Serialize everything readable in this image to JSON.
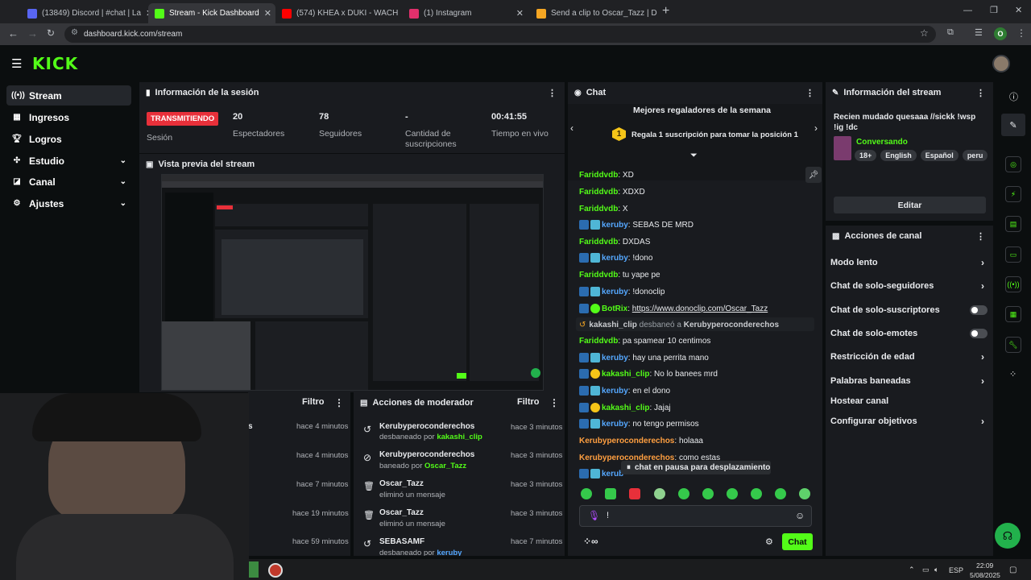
{
  "browser": {
    "tabs": [
      {
        "title": "(13849) Discord | #⁠chat | La",
        "fav": "#5865f2"
      },
      {
        "title": "Stream - Kick Dashboard",
        "fav": "#53fc18"
      },
      {
        "title": "(574) KHEA x DUKI - WACH",
        "fav": "#ff0000"
      },
      {
        "title": "(1) Instagram",
        "fav": "#e1306c"
      },
      {
        "title": "Send a clip to Oscar_Tazz | Don",
        "fav": "#f5a623"
      }
    ],
    "url": "dashboard.kick.com/stream",
    "profile_initial": "O"
  },
  "sidebar": {
    "items": [
      {
        "label": "Stream",
        "icon": "stream-icon"
      },
      {
        "label": "Ingresos",
        "icon": "revenue-icon"
      },
      {
        "label": "Logros",
        "icon": "trophy-icon"
      },
      {
        "label": "Estudio",
        "icon": "studio-icon"
      },
      {
        "label": "Canal",
        "icon": "channel-icon"
      },
      {
        "label": "Ajustes",
        "icon": "settings-icon"
      }
    ]
  },
  "session": {
    "title": "Información de la sesión",
    "live_badge": "TRANSMITIENDO",
    "session_label": "Sesión",
    "viewers": "20",
    "viewers_label": "Espectadores",
    "followers": "78",
    "followers_label": "Seguidores",
    "subs": "-",
    "subs_label": "Cantidad de suscripciones",
    "uptime": "00:41:55",
    "uptime_label": "Tiempo en vivo"
  },
  "preview": {
    "title": "Vista previa del stream"
  },
  "mod_left": {
    "filter": "Filtro",
    "times": [
      "hace 4 minutos",
      "hace 4 minutos",
      "hace 7 minutos",
      "hace 19 minutos",
      "hace 59 minutos"
    ],
    "stub": "s"
  },
  "mod_actions": {
    "title": "Acciones de moderador",
    "filter": "Filtro",
    "rows": [
      {
        "user": "Kerubyperoconderechos",
        "action": "desbaneado por",
        "by": "kakashi_clip",
        "time": "hace 3 minutos"
      },
      {
        "user": "Kerubyperoconderechos",
        "action": "baneado por",
        "by": "Oscar_Tazz",
        "time": "hace 3 minutos"
      },
      {
        "user": "Oscar_Tazz",
        "action": "eliminó un mensaje",
        "by": "",
        "time": "hace 3 minutos"
      },
      {
        "user": "Oscar_Tazz",
        "action": "eliminó un mensaje",
        "by": "",
        "time": "hace 3 minutos"
      },
      {
        "user": "SEBASAMF",
        "action": "desbaneado por",
        "by": "keruby",
        "time": "hace 7 minutos"
      }
    ]
  },
  "chat": {
    "title": "Chat",
    "gifters_title": "Mejores regaladores de la semana",
    "gift_cta": "Regala 1 suscripción para tomar la posición 1",
    "gift_rank": "1",
    "messages": [
      {
        "user": "Fariddvdb",
        "text": "XD",
        "color": "green",
        "badges": 0
      },
      {
        "user": "Fariddvdb",
        "text": "XDXD",
        "color": "green",
        "badges": 0
      },
      {
        "user": "Fariddvdb",
        "text": "X",
        "color": "green",
        "badges": 0
      },
      {
        "user": "keruby",
        "text": "SEBAS DE MRD",
        "color": "blue",
        "badges": 2
      },
      {
        "user": "Fariddvdb",
        "text": "DXDAS",
        "color": "green",
        "badges": 0
      },
      {
        "user": "keruby",
        "text": "!dono",
        "color": "blue",
        "badges": 2
      },
      {
        "user": "Fariddvdb",
        "text": "tu yape pe",
        "color": "green",
        "badges": 0
      },
      {
        "user": "keruby",
        "text": "!donoclip",
        "color": "blue",
        "badges": 2
      },
      {
        "user": "BotRix",
        "text": "https://www.donoclip.com/Oscar_Tazz",
        "color": "green",
        "badges": 2
      },
      {
        "user": "Fariddvdb",
        "text": "pa spamear 10 centimos",
        "color": "green",
        "badges": 0
      },
      {
        "user": "keruby",
        "text": "hay una perrita mano",
        "color": "blue",
        "badges": 2
      },
      {
        "user": "kakashi_clip",
        "text": "No lo banees mrd",
        "color": "green",
        "badges": 2
      },
      {
        "user": "keruby",
        "text": "en el dono",
        "color": "blue",
        "badges": 2
      },
      {
        "user": "kakashi_clip",
        "text": "Jajaj",
        "color": "green",
        "badges": 2
      },
      {
        "user": "keruby",
        "text": "no tengo permisos",
        "color": "blue",
        "badges": 2
      },
      {
        "user": "Kerubyperoconderechos",
        "text": "holaaa",
        "color": "orange",
        "badges": 0
      },
      {
        "user": "Kerubyperoconderechos",
        "text": "como estas",
        "color": "orange",
        "badges": 0
      }
    ],
    "system": {
      "user": "kakashi_clip",
      "action": "desbaneó a",
      "target": "Kerubyperoconderechos"
    },
    "last_partial": "kerub",
    "paused": "chat en pausa para desplazamiento",
    "input_value": "!",
    "send": "Chat"
  },
  "stream_info": {
    "title_label": "Información del stream",
    "stream_title": "Recien mudado quesaaa //sickk !wsp !ig !dc",
    "category": "Conversando",
    "tags": [
      "18+",
      "English",
      "Español",
      "peru"
    ],
    "edit": "Editar"
  },
  "channel_actions": {
    "title": "Acciones de canal",
    "items": [
      {
        "label": "Modo lento",
        "kind": "arrow"
      },
      {
        "label": "Chat de solo-seguidores",
        "kind": "arrow"
      },
      {
        "label": "Chat de solo-suscriptores",
        "kind": "toggle"
      },
      {
        "label": "Chat de solo-emotes",
        "kind": "toggle"
      },
      {
        "label": "Restricción de edad",
        "kind": "arrow"
      },
      {
        "label": "Palabras baneadas",
        "kind": "arrow"
      },
      {
        "label": "Hostear canal",
        "kind": "none"
      },
      {
        "label": "Configurar objetivos",
        "kind": "arrow"
      }
    ]
  },
  "taskbar": {
    "lang": "ESP",
    "time": "22:09",
    "date": "5/08/2025"
  },
  "colors": {
    "brand": "#53fc18",
    "live": "#e8303a",
    "panel": "#191b1f",
    "bg": "#0b0e0f"
  }
}
